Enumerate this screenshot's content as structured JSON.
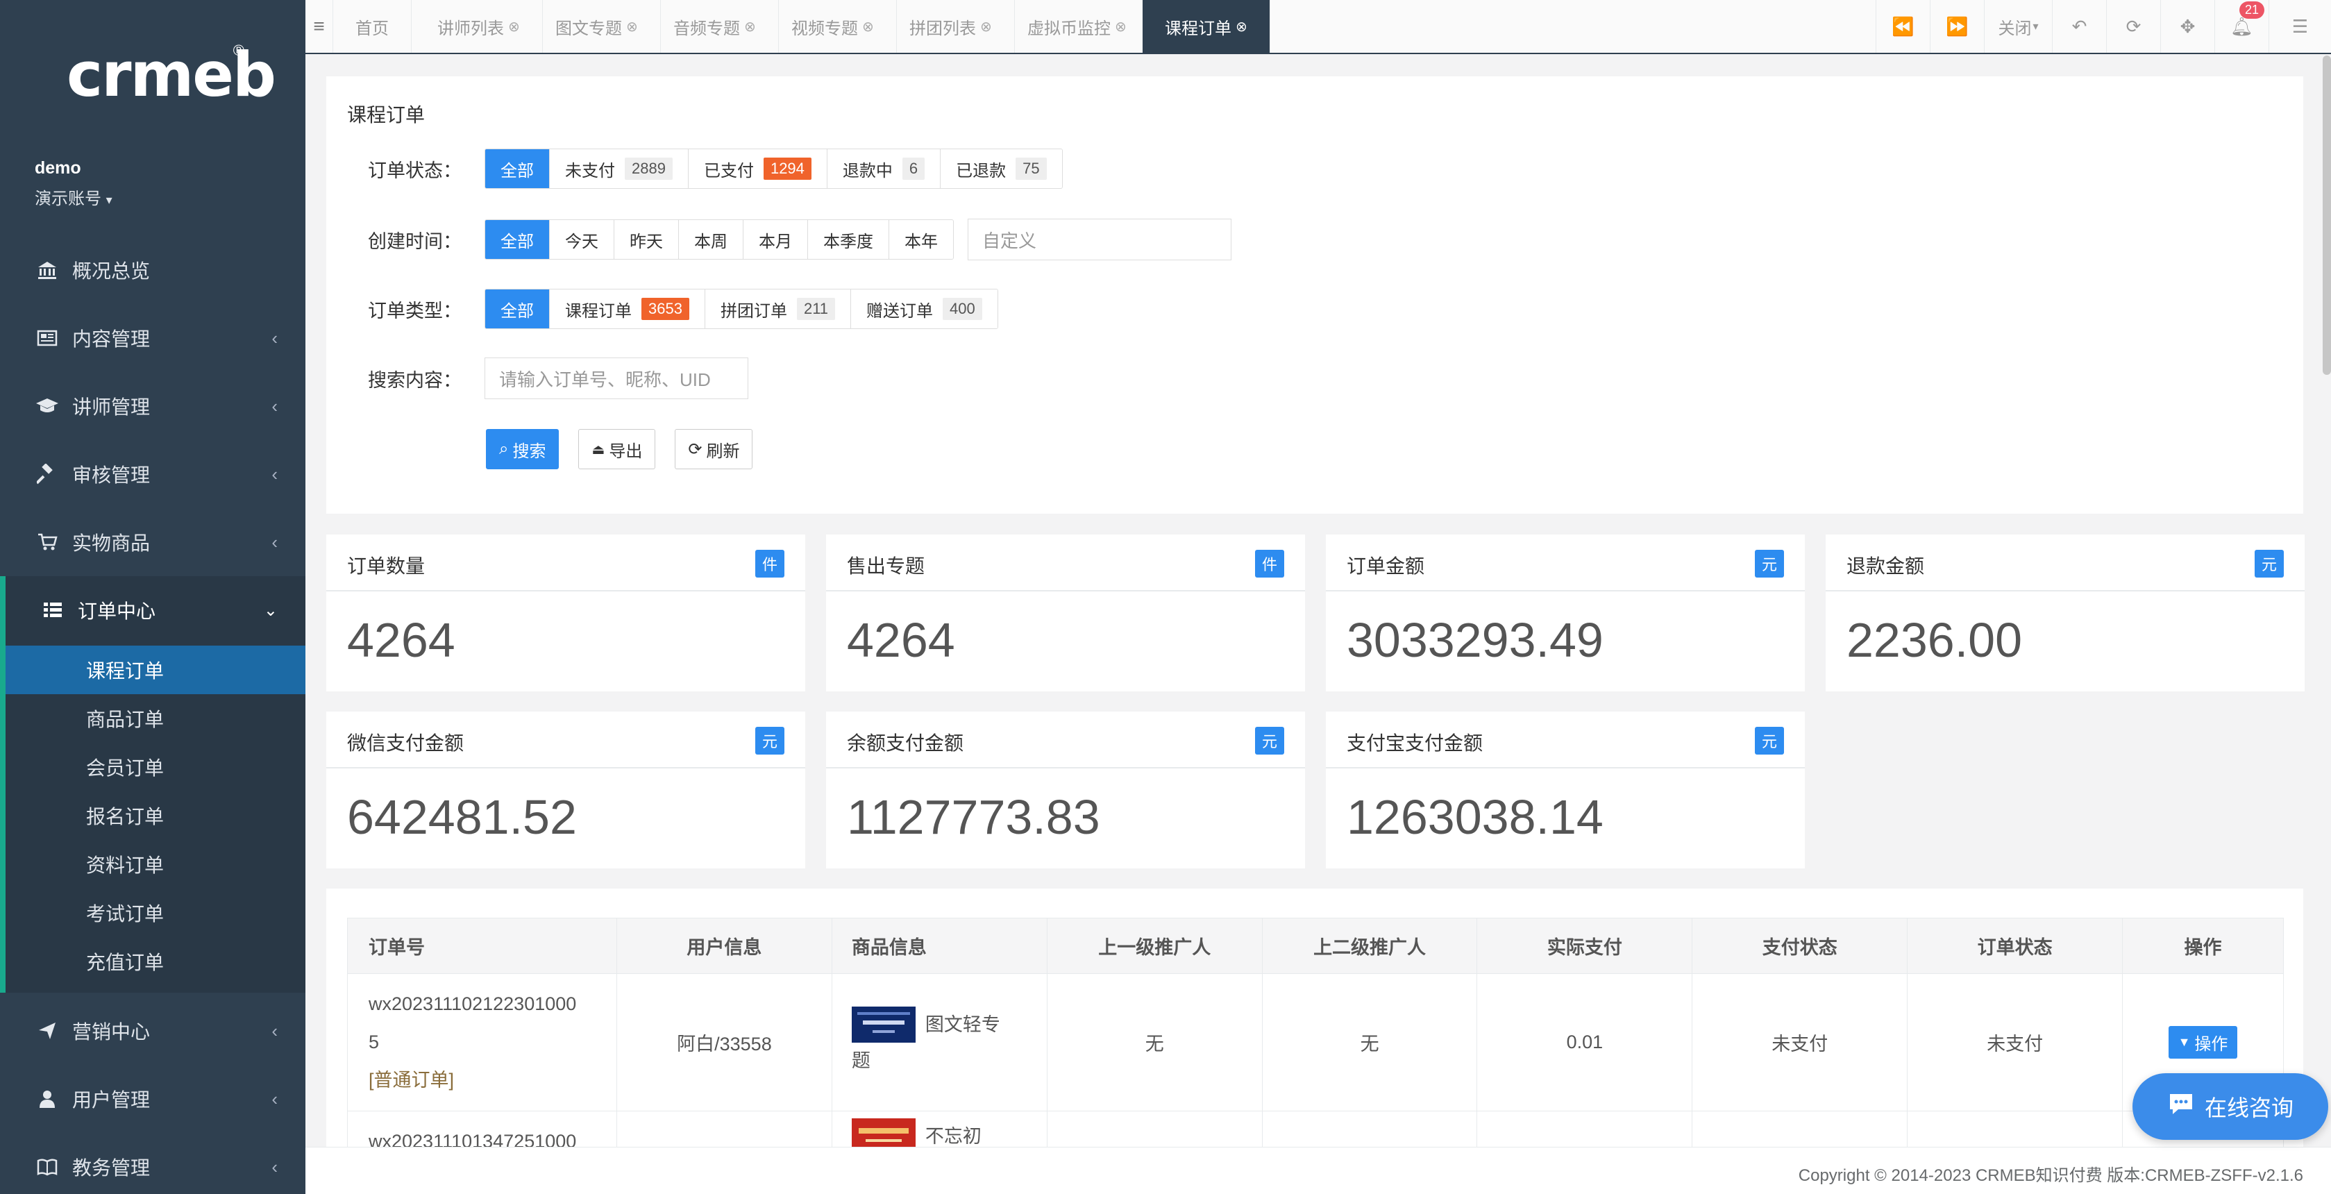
{
  "brand": {
    "logo_text": "crmeb",
    "registered": "®"
  },
  "user": {
    "name": "demo",
    "role": "演示账号"
  },
  "sidebar": {
    "items": [
      {
        "label": "概况总览",
        "icon": "bank-icon"
      },
      {
        "label": "内容管理",
        "icon": "newspaper-icon"
      },
      {
        "label": "讲师管理",
        "icon": "graduation-cap-icon"
      },
      {
        "label": "审核管理",
        "icon": "gavel-icon"
      },
      {
        "label": "实物商品",
        "icon": "cart-icon"
      }
    ],
    "active_group": {
      "label": "订单中心",
      "icon": "list-icon"
    },
    "sub_items": [
      "课程订单",
      "商品订单",
      "会员订单",
      "报名订单",
      "资料订单",
      "考试订单",
      "充值订单"
    ],
    "bottom_items": [
      {
        "label": "营销中心",
        "icon": "send-icon"
      },
      {
        "label": "用户管理",
        "icon": "user-icon"
      },
      {
        "label": "教务管理",
        "icon": "book-icon"
      }
    ]
  },
  "tabs": [
    {
      "label": "首页"
    },
    {
      "label": "讲师列表"
    },
    {
      "label": "图文专题"
    },
    {
      "label": "音频专题"
    },
    {
      "label": "视频专题"
    },
    {
      "label": "拼团列表"
    },
    {
      "label": "虚拟币监控"
    },
    {
      "label": "课程订单"
    }
  ],
  "toolbar": {
    "close_label": "关闭",
    "notification_count": "21"
  },
  "filters": {
    "title": "课程订单",
    "status": {
      "label": "订单状态：",
      "options": [
        {
          "text": "全部"
        },
        {
          "text": "未支付",
          "count": "2889"
        },
        {
          "text": "已支付",
          "count": "1294"
        },
        {
          "text": "退款中",
          "count": "6"
        },
        {
          "text": "已退款",
          "count": "75"
        }
      ]
    },
    "time": {
      "label": "创建时间：",
      "options": [
        "全部",
        "今天",
        "昨天",
        "本周",
        "本月",
        "本季度",
        "本年"
      ],
      "custom_placeholder": "自定义"
    },
    "type": {
      "label": "订单类型：",
      "options": [
        {
          "text": "全部"
        },
        {
          "text": "课程订单",
          "count": "3653"
        },
        {
          "text": "拼团订单",
          "count": "211"
        },
        {
          "text": "赠送订单",
          "count": "400"
        }
      ]
    },
    "search": {
      "label": "搜索内容：",
      "placeholder": "请输入订单号、昵称、UID"
    },
    "buttons": {
      "search": "搜索",
      "export": "导出",
      "refresh": "刷新"
    }
  },
  "stats": [
    {
      "title": "订单数量",
      "unit": "件",
      "value": "4264"
    },
    {
      "title": "售出专题",
      "unit": "件",
      "value": "4264"
    },
    {
      "title": "订单金额",
      "unit": "元",
      "value": "3033293.49"
    },
    {
      "title": "退款金额",
      "unit": "元",
      "value": "2236.00"
    },
    {
      "title": "微信支付金额",
      "unit": "元",
      "value": "642481.52"
    },
    {
      "title": "余额支付金额",
      "unit": "元",
      "value": "1127773.83"
    },
    {
      "title": "支付宝支付金额",
      "unit": "元",
      "value": "1263038.14"
    }
  ],
  "table": {
    "headers": [
      "订单号",
      "用户信息",
      "商品信息",
      "上一级推广人",
      "上二级推广人",
      "实际支付",
      "支付状态",
      "订单状态",
      "操作"
    ],
    "rows": [
      {
        "order_no_1": "wx202311102122301000",
        "order_no_2": "5",
        "order_type": "[普通订单]",
        "user": "阿白/33558",
        "goods_1": "图文轻专",
        "goods_2": "题",
        "ref1": "无",
        "ref2": "无",
        "paid": "0.01",
        "pay_status": "未支付",
        "order_status": "未支付",
        "action": "操作"
      },
      {
        "order_no_1": "wx202311101347251000",
        "goods_1": "不忘初"
      }
    ]
  },
  "footer": {
    "copyright": "Copyright © 2014-2023 CRMEB知识付费 版本:CRMEB-ZSFF-v2.1.6"
  },
  "float_button": {
    "label": "在线咨询"
  },
  "colors": {
    "primary": "#2d8cf0",
    "sidebar_bg": "#2f4050",
    "hot_count": "#f0632b",
    "active_sub": "#1c6aa5"
  }
}
